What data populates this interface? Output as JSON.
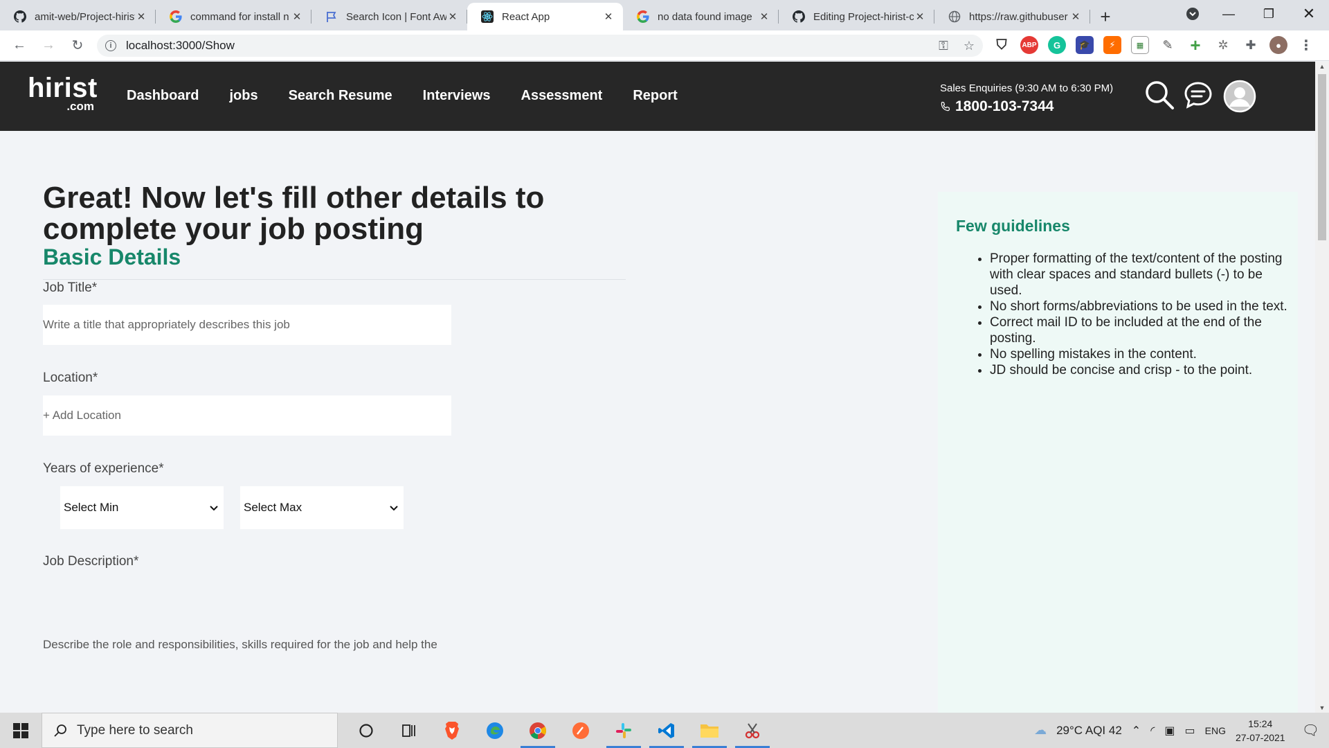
{
  "browser": {
    "tabs": [
      {
        "title": "amit-web/Project-hirist",
        "icon": "github-icon",
        "active": false
      },
      {
        "title": "command for install n",
        "icon": "google-icon",
        "active": false
      },
      {
        "title": "Search Icon | Font Aw",
        "icon": "flag-icon",
        "active": false
      },
      {
        "title": "React App",
        "icon": "react-icon",
        "active": true
      },
      {
        "title": "no data found image",
        "icon": "google-icon",
        "active": false
      },
      {
        "title": "Editing Project-hirist-c",
        "icon": "github-icon",
        "active": false
      },
      {
        "title": "https://raw.githubuser",
        "icon": "globe-icon",
        "active": false
      }
    ],
    "url": "localhost:3000/Show"
  },
  "header": {
    "logo_main": "hirist",
    "logo_sub": ".com",
    "nav": [
      "Dashboard",
      "jobs",
      "Search Resume",
      "Interviews",
      "Assessment",
      "Report"
    ],
    "sales_label": "Sales Enquiries (9:30 AM to 6:30 PM)",
    "sales_phone": "1800-103-7344"
  },
  "form": {
    "title": "Great! Now let's fill other details to complete your job posting",
    "section": "Basic Details",
    "job_title_label": "Job Title*",
    "job_title_placeholder": "Write a title that appropriately describes this job",
    "location_label": "Location*",
    "location_placeholder": "+ Add Location",
    "experience_label": "Years of experience*",
    "select_min": "Select Min",
    "select_max": "Select Max",
    "description_label": "Job Description*",
    "description_text": "Describe the role and responsibilities, skills required for the job and help the"
  },
  "guidelines": {
    "title": "Few guidelines",
    "items": [
      "Proper formatting of the text/content of the posting with clear spaces and standard bullets (-) to be used.",
      "No short forms/abbreviations to be used in the text.",
      "Correct mail ID to be included at the end of the posting.",
      "No spelling mistakes in the content.",
      "JD should be concise and crisp - to the point."
    ]
  },
  "taskbar": {
    "search_placeholder": "Type here to search",
    "weather": "29°C  AQI 42",
    "language": "ENG",
    "time": "15:24",
    "date": "27-07-2021"
  },
  "colors": {
    "header_bg": "#272727",
    "accent_green": "#17876a",
    "guidelines_bg": "#eef9f6",
    "page_bg": "#f2f4f7"
  }
}
